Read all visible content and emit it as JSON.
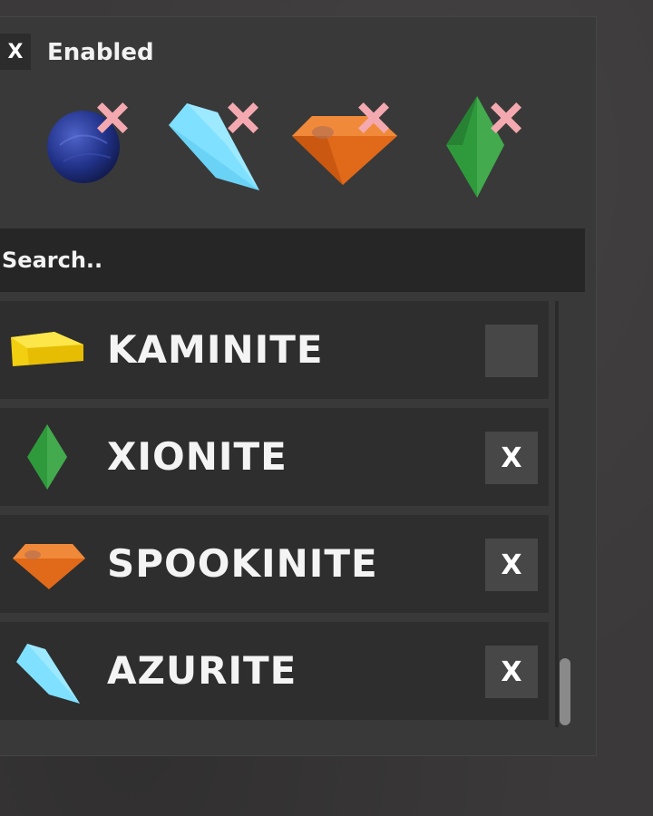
{
  "header": {
    "toggle_label": "X",
    "enabled_label": "Enabled"
  },
  "selected_ores": [
    {
      "name": "blue-orb",
      "remove_icon": "pink-x-icon",
      "color": "#22338a"
    },
    {
      "name": "azurite",
      "remove_icon": "pink-x-icon",
      "color": "#7fe0ff"
    },
    {
      "name": "spookinite",
      "remove_icon": "pink-x-icon",
      "color": "#e06a1a"
    },
    {
      "name": "xionite",
      "remove_icon": "pink-x-icon",
      "color": "#2f9a3c"
    }
  ],
  "search": {
    "placeholder": "Search.."
  },
  "ores": [
    {
      "name": "KAMINITE",
      "checked_label": "",
      "icon": "yellow-gold-ingot-icon"
    },
    {
      "name": "XIONITE",
      "checked_label": "X",
      "icon": "green-diamond-gem-icon"
    },
    {
      "name": "SPOOKINITE",
      "checked_label": "X",
      "icon": "orange-cut-gem-icon"
    },
    {
      "name": "AZURITE",
      "checked_label": "X",
      "icon": "cyan-shard-gem-icon"
    }
  ],
  "colors": {
    "panel_bg": "#393939",
    "row_bg": "#2e2e2e",
    "search_bg": "#262626",
    "checkbox_bg": "#474747",
    "remove_x": "#f4a9b0"
  }
}
